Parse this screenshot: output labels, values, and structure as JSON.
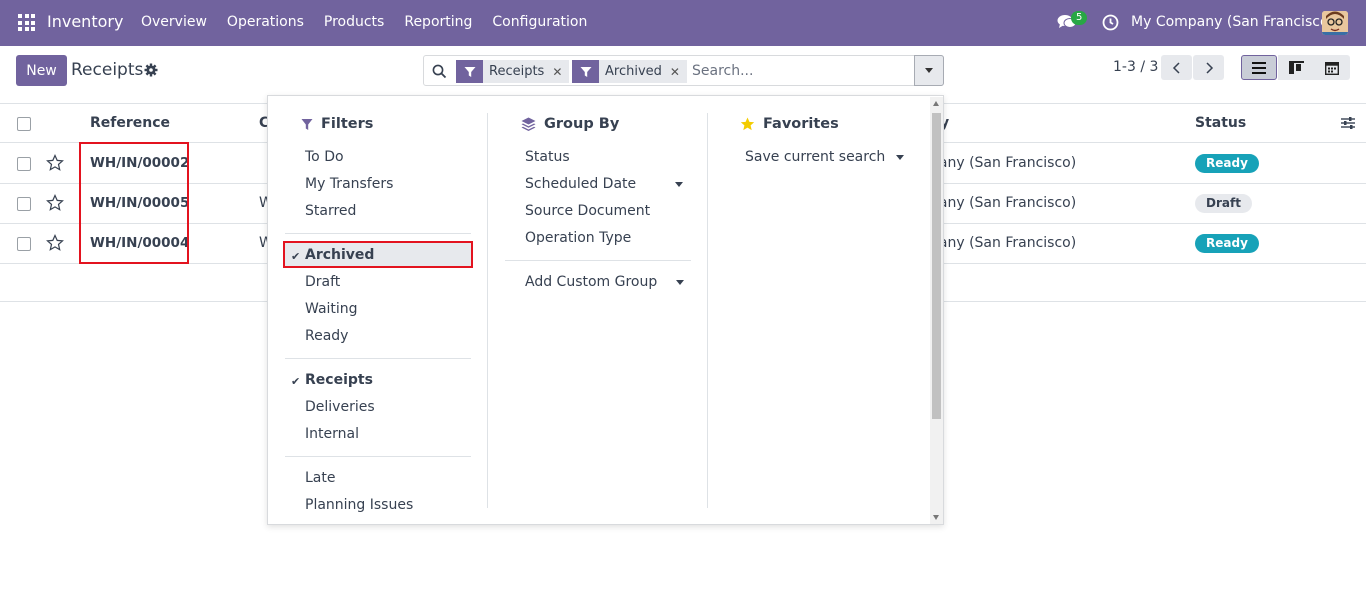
{
  "navbar": {
    "app_name": "Inventory",
    "menu": [
      "Overview",
      "Operations",
      "Products",
      "Reporting",
      "Configuration"
    ],
    "chat_badge": "5",
    "company": "My Company (San Francisco)",
    "icons": [
      "apps-icon",
      "chat-icon",
      "clock-icon",
      "avatar"
    ]
  },
  "control": {
    "new_label": "New",
    "breadcrumb": "Receipts",
    "facets": [
      {
        "label": "Receipts",
        "icon": "filter-icon"
      },
      {
        "label": "Archived",
        "icon": "filter-icon"
      }
    ],
    "search_placeholder": "Search...",
    "pager": "1-3 / 3"
  },
  "list": {
    "columns": [
      "Reference",
      "C",
      "y",
      "Status"
    ],
    "rows": [
      {
        "reference": "WH/IN/00002",
        "w": "",
        "company": "pany (San Francisco)",
        "status": "Ready",
        "status_type": "ready"
      },
      {
        "reference": "WH/IN/00005",
        "w": "W",
        "company": "pany (San Francisco)",
        "status": "Draft",
        "status_type": "draft"
      },
      {
        "reference": "WH/IN/00004",
        "w": "W",
        "company": "pany (San Francisco)",
        "status": "Ready",
        "status_type": "ready"
      }
    ]
  },
  "dropdown": {
    "filters_title": "Filters",
    "filters": {
      "group1": [
        "To Do",
        "My Transfers",
        "Starred"
      ],
      "group2": [
        "Archived",
        "Draft",
        "Waiting",
        "Ready"
      ],
      "group3": [
        "Receipts",
        "Deliveries",
        "Internal"
      ],
      "group4": [
        "Late",
        "Planning Issues"
      ]
    },
    "checked": [
      "Archived",
      "Receipts"
    ],
    "groupby_title": "Group By",
    "groupby": [
      "Status",
      "Scheduled Date",
      "Source Document",
      "Operation Type"
    ],
    "add_custom_group": "Add Custom Group",
    "favorites_title": "Favorites",
    "save_current_search": "Save current search"
  },
  "colors": {
    "brand": "#71639e",
    "ready": "#17a2b8",
    "highlight": "#e3131f"
  }
}
